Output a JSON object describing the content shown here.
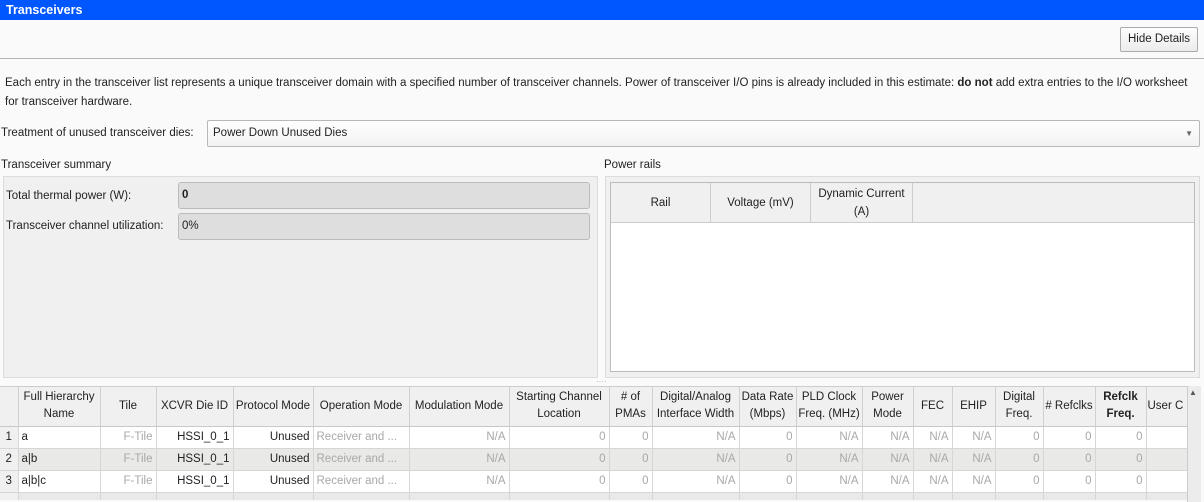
{
  "window": {
    "title": "Transceivers"
  },
  "toolbar": {
    "hide_details_label": "Hide Details"
  },
  "description": {
    "part1": "Each entry in the transceiver list represents a unique transceiver domain with a specified number of transceiver channels. Power of transceiver I/O pins is already included in this estimate: ",
    "bold": "do not",
    "part2": " add extra entries to the I/O worksheet for transceiver hardware."
  },
  "treatment": {
    "label": "Treatment of unused transceiver dies:",
    "value": "Power Down Unused Dies"
  },
  "summary": {
    "title": "Transceiver summary",
    "fields": [
      {
        "label": "Total thermal power (W):",
        "value": "0"
      },
      {
        "label": "Transceiver channel utilization:",
        "value": "0%"
      }
    ]
  },
  "power_rails": {
    "title": "Power rails",
    "columns": [
      "Rail",
      "Voltage (mV)",
      "Dynamic Current (A)"
    ]
  },
  "grid": {
    "columns": [
      "Full Hierarchy Name",
      "Tile",
      "XCVR Die ID",
      "Protocol Mode",
      "Operation Mode",
      "Modulation Mode",
      "Starting Channel Location",
      "# of PMAs",
      "Digital/Analog Interface Width",
      "Data Rate (Mbps)",
      "PLD Clock Freq. (MHz)",
      "Power Mode",
      "FEC",
      "EHIP",
      "Digital Freq.",
      "# Refclks",
      "Refclk Freq.",
      "User C"
    ],
    "rows": [
      {
        "num": "1",
        "cells": [
          "a",
          "F-Tile",
          "HSSI_0_1",
          "Unused",
          "Receiver and ...",
          "N/A",
          "0",
          "0",
          "N/A",
          "0",
          "N/A",
          "N/A",
          "N/A",
          "N/A",
          "0",
          "0",
          "0",
          ""
        ]
      },
      {
        "num": "2",
        "cells": [
          "a|b",
          "F-Tile",
          "HSSI_0_1",
          "Unused",
          "Receiver and ...",
          "N/A",
          "0",
          "0",
          "N/A",
          "0",
          "N/A",
          "N/A",
          "N/A",
          "N/A",
          "0",
          "0",
          "0",
          ""
        ]
      },
      {
        "num": "3",
        "cells": [
          "a|b|c",
          "F-Tile",
          "HSSI_0_1",
          "Unused",
          "Receiver and ...",
          "N/A",
          "0",
          "0",
          "N/A",
          "0",
          "N/A",
          "N/A",
          "N/A",
          "N/A",
          "0",
          "0",
          "0",
          ""
        ]
      }
    ]
  },
  "colors": {
    "titlebar": "#0057ff"
  }
}
